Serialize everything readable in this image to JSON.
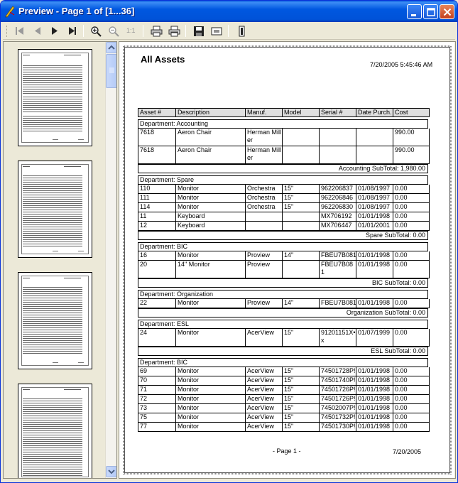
{
  "window": {
    "title": "Preview - Page 1 of [1...36]"
  },
  "toolbar": {
    "buttons": [
      {
        "name": "first-page",
        "icon": "first-page-icon"
      },
      {
        "name": "previous-page",
        "icon": "previous-page-icon"
      },
      {
        "name": "next-page",
        "icon": "next-page-icon"
      },
      {
        "name": "last-page",
        "icon": "last-page-icon"
      },
      {
        "name": "zoom-in",
        "icon": "zoom-in-icon"
      },
      {
        "name": "zoom-out",
        "icon": "zoom-out-icon"
      },
      {
        "name": "actual-size",
        "icon": "actual-size-icon"
      },
      {
        "name": "print",
        "icon": "print-icon"
      },
      {
        "name": "print-setup",
        "icon": "print-setup-icon"
      },
      {
        "name": "save",
        "icon": "save-icon"
      },
      {
        "name": "export",
        "icon": "export-icon"
      },
      {
        "name": "close",
        "icon": "book-icon"
      }
    ],
    "actual_size_label": "1:1"
  },
  "report": {
    "title": "All Assets",
    "date": "7/20/2005 5:45:46 AM",
    "columns": [
      "Asset #",
      "Description",
      "Manuf.",
      "Model",
      "Serial #",
      "Date Purch.",
      "Cost"
    ],
    "groups": [
      {
        "department": "Department: Accounting",
        "rows": [
          [
            "7618",
            "Aeron Chair",
            "Herman Miller",
            "",
            "",
            "",
            "990.00"
          ],
          [
            "7618",
            "Aeron Chair",
            "Herman Miller",
            "",
            "",
            "",
            "990.00"
          ]
        ],
        "subtotal": "Accounting SubTotal: 1,980.00"
      },
      {
        "department": "Department: Spare",
        "rows": [
          [
            "110",
            "Monitor",
            "Orchestra",
            "15\"",
            "962206837",
            "01/08/1997",
            "0.00"
          ],
          [
            "111",
            "Monitor",
            "Orchestra",
            "15\"",
            "962206846",
            "01/08/1997",
            "0.00"
          ],
          [
            "114",
            "Monitor",
            "Orchestra",
            "15\"",
            "962206830",
            "01/08/1997",
            "0.00"
          ],
          [
            "11",
            "Keyboard",
            "",
            "",
            "MX706192",
            "01/01/1998",
            "0.00"
          ],
          [
            "12",
            "Keyboard",
            "",
            "",
            "MX706447",
            "01/01/2001",
            "0.00"
          ]
        ],
        "subtotal": "Spare SubTotal: 0.00"
      },
      {
        "department": "Department: BIC",
        "rows": [
          [
            "16",
            "Monitor",
            "Proview",
            "14\"",
            "FBEU7B081",
            "01/01/1998",
            "0.00"
          ],
          [
            "20",
            "14\" Monitor",
            "Proview",
            "",
            "FBEU7B081",
            "01/01/1998",
            "0.00"
          ]
        ],
        "subtotal": "BIC SubTotal: 0.00"
      },
      {
        "department": "Department: Organization",
        "rows": [
          [
            "22",
            "Monitor",
            "Proview",
            "14\"",
            "FBEU7B081",
            "01/01/1998",
            "0.00"
          ]
        ],
        "subtotal": "Organization SubTotal: 0.00"
      },
      {
        "department": "Department: ESL",
        "rows": [
          [
            "24",
            "Monitor",
            "AcerView",
            "15\"",
            "91201151X• x",
            "01/07/1999",
            "0.00"
          ]
        ],
        "subtotal": "ESL SubTotal: 0.00"
      },
      {
        "department": "Department: BIC",
        "rows": [
          [
            "69",
            "Monitor",
            "AcerView",
            "15\"",
            "74501728P!",
            "01/01/1998",
            "0.00"
          ],
          [
            "70",
            "Monitor",
            "AcerView",
            "15\"",
            "74501740P!",
            "01/01/1998",
            "0.00"
          ],
          [
            "71",
            "Monitor",
            "AcerView",
            "15\"",
            "74501726P!",
            "01/01/1998",
            "0.00"
          ],
          [
            "72",
            "Monitor",
            "AcerView",
            "15\"",
            "74501726P!",
            "01/01/1998",
            "0.00"
          ],
          [
            "73",
            "Monitor",
            "AcerView",
            "15\"",
            "74502007P!",
            "01/01/1998",
            "0.00"
          ],
          [
            "75",
            "Monitor",
            "AcerView",
            "15\"",
            "74501732P!",
            "01/01/1998",
            "0.00"
          ],
          [
            "77",
            "Monitor",
            "AcerView",
            "15\"",
            "74501730P!",
            "01/01/1998",
            "0.00"
          ]
        ],
        "subtotal": ""
      }
    ],
    "footer_page": "- Page 1 -",
    "footer_date": "7/20/2005"
  },
  "thumbnails": {
    "pages": [
      "page-1",
      "page-2",
      "page-3",
      "page-4"
    ]
  }
}
